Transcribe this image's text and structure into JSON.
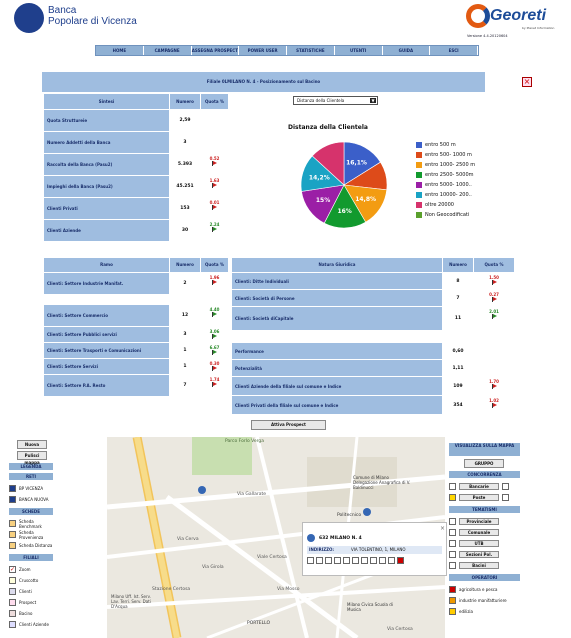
{
  "header": {
    "bank_line1": "Banca",
    "bank_line2": "Popolare di Vicenza",
    "brand": "Georeti",
    "brand_sub": "by Planet Information",
    "version": "Versione 4.4.20120604"
  },
  "menu": [
    "HOME",
    "CAMPAGNE",
    "ASSEGNA PROSPECT",
    "POWER USER",
    "STATISTICHE",
    "UTENTI",
    "GUIDA",
    "ESCI"
  ],
  "panel": {
    "title": "Filiale 0LMILANO N. 4 - Posizionamento sul Bacino",
    "sintesi_hdr": "Sintesi",
    "numero_hdr": "Numero",
    "quota_hdr": "Quota %",
    "sintesi": [
      {
        "label": "Quota Struttureie",
        "num": "2,59",
        "quota": ""
      },
      {
        "label": "Numero Addetti della Banca",
        "num": "3",
        "quota": ""
      },
      {
        "label": "Raccolta della Banca (Pasu2)",
        "num": "5.393",
        "quota": "0.52"
      },
      {
        "label": "Impieghi della Banca (Pasu2)",
        "num": "45.251",
        "quota": "1.63"
      },
      {
        "label": "Clienti Privati",
        "num": "153",
        "quota": "0.01"
      },
      {
        "label": "Clienti Aziende",
        "num": "30",
        "quota": "2.24"
      }
    ],
    "dropdown": "Distanza della Clientela",
    "ramo_hdr": "Ramo",
    "natura_hdr": "Natura Giuridica",
    "ramo": [
      {
        "label": "Clienti: Settore Industrie Manifat.",
        "num": "2",
        "quota": "1.96"
      },
      {
        "label": "Clienti: Settore Commercio",
        "num": "12",
        "quota": "4.40"
      },
      {
        "label": "Clienti: Settore Pubblici servizi",
        "num": "3",
        "quota": "3.06"
      },
      {
        "label": "Clienti: Settore Trasporti e Comunicazioni",
        "num": "1",
        "quota": "6.67"
      },
      {
        "label": "Clienti: Settore Servizi",
        "num": "1",
        "quota": "0.30"
      },
      {
        "label": "Clienti: Settore P.A. Resto",
        "num": "7",
        "quota": "1.74"
      }
    ],
    "natura": [
      {
        "label": "Clienti: Ditte Individuali",
        "num": "8",
        "quota": "1.50"
      },
      {
        "label": "Clienti: Società di Persone",
        "num": "7",
        "quota": "0.27"
      },
      {
        "label": "Clienti: Società diCapitale",
        "num": "11",
        "quota": "2.01"
      },
      {
        "label": "Performance",
        "num": "0,60",
        "quota": ""
      },
      {
        "label": "Potenzialità",
        "num": "1,11",
        "quota": ""
      },
      {
        "label": "Clienti Aziende della filiale sul comune e Indice",
        "num": "109",
        "quota": "1.70"
      },
      {
        "label": "Clienti Privati della filiale sul comune e Indice",
        "num": "354",
        "quota": "1.02"
      }
    ],
    "activate_btn": "Attiva Prospect"
  },
  "chart_data": {
    "type": "pie",
    "title": "Distanza della Clientela",
    "categories": [
      "entro 500 m",
      "entro 500- 1000 m",
      "entro 1000- 2500 m",
      "entro 2500- 5000m",
      "entro 5000- 1000..",
      "entro 10000- 200..",
      "oltre 20000",
      "Non Geocodificati"
    ],
    "values": [
      16.1,
      10.7,
      14.8,
      16,
      15,
      14.2,
      13.2,
      0
    ],
    "labels": [
      "16,1%",
      "",
      "14,8%",
      "16%",
      "15%",
      "14,2%",
      "",
      ""
    ],
    "colors": [
      "#3b5fc9",
      "#dd4b1a",
      "#f39c12",
      "#129a2e",
      "#9b1fa6",
      "#1aa3c4",
      "#d6336c",
      "#5aa02c"
    ]
  },
  "left_sidebar": {
    "buttons": [
      "Nuova",
      "Pulisci mappa"
    ],
    "legenda": "LEGENDA",
    "reti": "RETI",
    "reti_items": [
      "BP VICENZA",
      "BANCA NUOVA"
    ],
    "schede": "SCHEDE",
    "schede_items": [
      "Scheda Benchmark",
      "Scheda Provenienza",
      "Scheda Distanza"
    ],
    "filiali": "FILIALI",
    "filiali_items": [
      "Zoom",
      "Cruscotto",
      "Clienti",
      "Prospect",
      "Bacino",
      "Clienti Aziende"
    ]
  },
  "right_sidebar": {
    "visualizza": "VISUALIZZA SULLA MAPPA",
    "gruppo": "GRUPPO",
    "concorrenza": "CONCORRENZA",
    "conc_items": [
      "Bancarie",
      "Poste"
    ],
    "tematismi": "TEMATISMI",
    "tem_items": [
      "Provinciale",
      "Comunale",
      "UTB",
      "Sezioni Pol.",
      "Bacini"
    ],
    "operatori": "OPERATORI",
    "op_items": [
      "agricoltura e pesca",
      "industrie manifatturiere",
      "edilizia"
    ]
  },
  "map": {
    "labels": [
      "Parco Forlo Verga",
      "Comune di Milano Delegazione Anagrafica di V. Baldinucci",
      "Politecnico",
      "Via Gallarate",
      "Stazione Certosa",
      "Via Cerva",
      "Milano Uff. Ist. Serv. Lav. Terri. Serv. Dati D'Acqua",
      "Via Mosso",
      "Milano Civica Scuola di Musica",
      "PORTELLO",
      "Via Certosa",
      "Viale Certosa",
      "Via Girola"
    ],
    "popup_title": "632 MILANO N. 4",
    "popup_label": "INDIRIZZO:",
    "popup_address": "VIA TOLENTINO, 1, MILANO"
  }
}
